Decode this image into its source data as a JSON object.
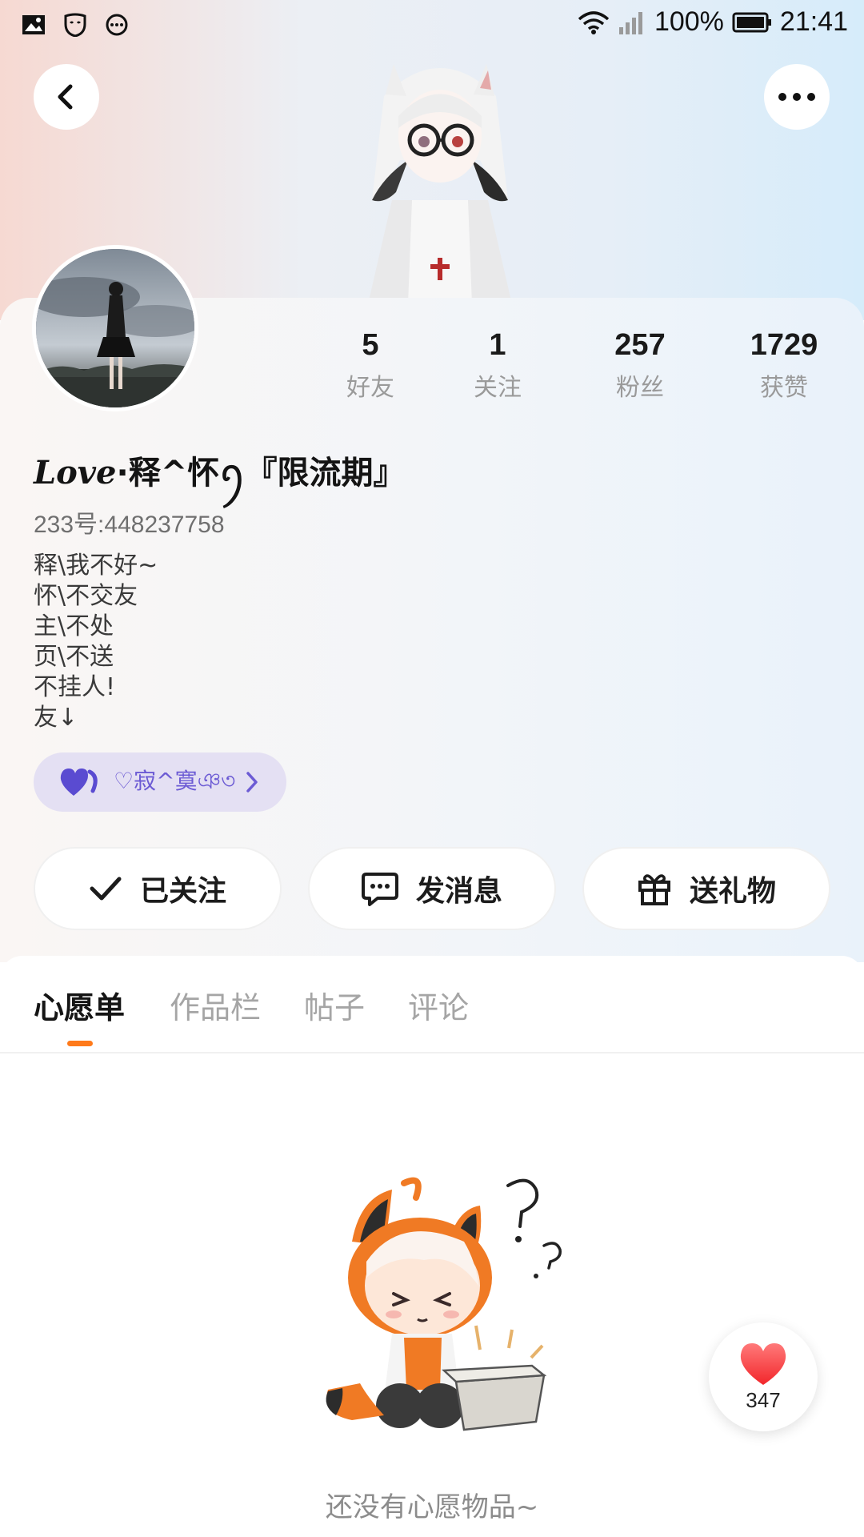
{
  "status_bar": {
    "battery": "100%",
    "time": "21:41",
    "left_icons": [
      "image-icon",
      "mask-icon",
      "chat-bubble-icon"
    ],
    "right_icons": [
      "wifi-icon",
      "signal-icon",
      "battery-icon"
    ]
  },
  "header": {
    "back_icon": "chevron-left-icon",
    "more_icon": "more-dots-icon"
  },
  "profile": {
    "stats": [
      {
        "value": "5",
        "label": "好友"
      },
      {
        "value": "1",
        "label": "关注"
      },
      {
        "value": "257",
        "label": "粉丝"
      },
      {
        "value": "1729",
        "label": "获赞"
      }
    ],
    "nickname_script": "Love",
    "nickname_rest": "·释^怀ꪆ『限流期』",
    "uid": "233号:448237758",
    "bio": [
      "释\\我不好~",
      "怀\\不交友",
      "主\\不处",
      "页\\不送",
      "不挂人!",
      "友↓"
    ],
    "group_chip": {
      "label": "♡寂^寞ঞ৩",
      "icon": "heart-icon"
    }
  },
  "actions": {
    "follow": "已关注",
    "message": "发消息",
    "gift": "送礼物"
  },
  "tabs": [
    "心愿单",
    "作品栏",
    "帖子",
    "评论"
  ],
  "active_tab": "心愿单",
  "empty_state": {
    "text": "还没有心愿物品~"
  },
  "like_fab": {
    "count": "347"
  },
  "colors": {
    "accent": "#ff7a1a",
    "chip_bg": "#e4e0f3",
    "chip_text": "#6c5bd4"
  }
}
